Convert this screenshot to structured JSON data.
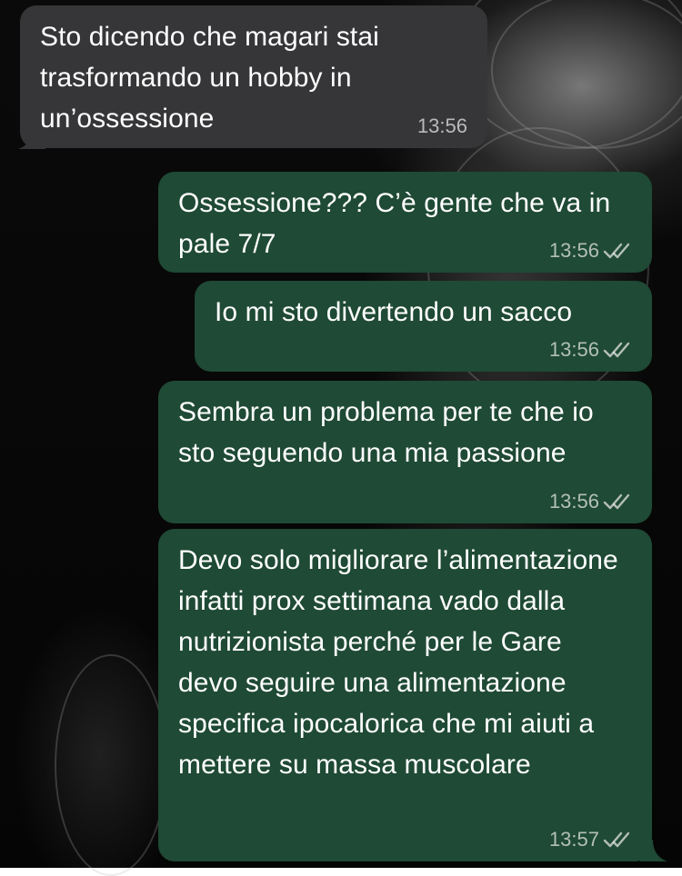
{
  "wallpaper": {
    "description_icon": "photo-wallpaper"
  },
  "colors": {
    "incoming_bubble": "#363638",
    "outgoing_bubble": "#1f4a35",
    "text": "#ffffff",
    "timestamp": "#ebebeb"
  },
  "messages": [
    {
      "direction": "incoming",
      "text": "Sto dicendo che magari stai trasformando un hobby in un’ossessione",
      "time": "13:56",
      "read": false
    },
    {
      "direction": "outgoing",
      "text": "Ossessione??? C’è gente che va in pale 7/7",
      "time": "13:56",
      "read": true
    },
    {
      "direction": "outgoing",
      "text": "Io mi sto divertendo un sacco",
      "time": "13:56",
      "read": true
    },
    {
      "direction": "outgoing",
      "text": "Sembra un problema per te che io sto seguendo una mia passione",
      "time": "13:56",
      "read": true
    },
    {
      "direction": "outgoing",
      "text": "Devo solo migliorare l’alimentazione infatti prox settimana vado dalla nutrizionista perché per le Gare devo seguire una alimentazione specifica ipocalorica che mi aiuti a mettere su massa muscolare",
      "time": "13:57",
      "read": true
    }
  ]
}
